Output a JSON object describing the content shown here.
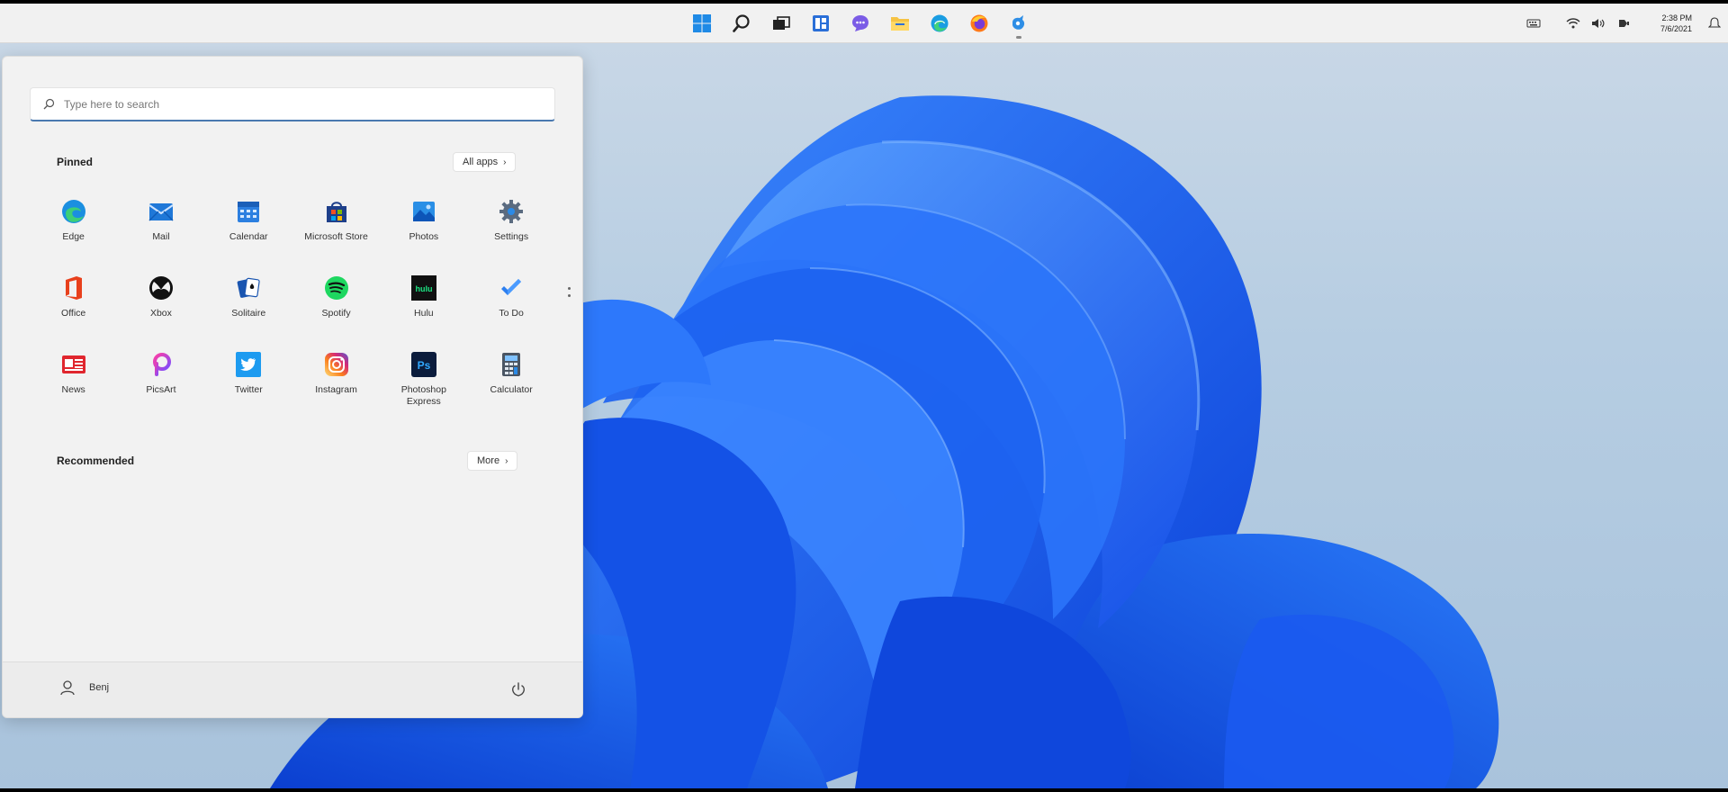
{
  "taskbar": {
    "apps": [
      {
        "name": "start-button",
        "icon": "windows-logo-icon"
      },
      {
        "name": "search-button",
        "icon": "search-icon"
      },
      {
        "name": "task-view-button",
        "icon": "task-view-icon"
      },
      {
        "name": "widgets-button",
        "icon": "widgets-icon"
      },
      {
        "name": "chat-button",
        "icon": "chat-icon"
      },
      {
        "name": "file-explorer-button",
        "icon": "folder-icon"
      },
      {
        "name": "edge-button",
        "icon": "edge-icon"
      },
      {
        "name": "firefox-button",
        "icon": "firefox-icon"
      },
      {
        "name": "app-button",
        "icon": "app-icon"
      }
    ],
    "clock": {
      "time": "2:38 PM",
      "date": "7/6/2021"
    }
  },
  "start_menu": {
    "search": {
      "placeholder": "Type here to search"
    },
    "pinned": {
      "title": "Pinned",
      "all_apps_label": "All apps",
      "apps": [
        {
          "label": "Edge",
          "icon": "edge-icon"
        },
        {
          "label": "Mail",
          "icon": "mail-icon"
        },
        {
          "label": "Calendar",
          "icon": "calendar-icon"
        },
        {
          "label": "Microsoft Store",
          "icon": "store-icon"
        },
        {
          "label": "Photos",
          "icon": "photos-icon"
        },
        {
          "label": "Settings",
          "icon": "gear-icon"
        },
        {
          "label": "Office",
          "icon": "office-icon"
        },
        {
          "label": "Xbox",
          "icon": "xbox-icon"
        },
        {
          "label": "Solitaire",
          "icon": "solitaire-icon"
        },
        {
          "label": "Spotify",
          "icon": "spotify-icon"
        },
        {
          "label": "Hulu",
          "icon": "hulu-icon"
        },
        {
          "label": "To Do",
          "icon": "todo-icon"
        },
        {
          "label": "News",
          "icon": "news-icon"
        },
        {
          "label": "PicsArt",
          "icon": "picsart-icon"
        },
        {
          "label": "Twitter",
          "icon": "twitter-icon"
        },
        {
          "label": "Instagram",
          "icon": "instagram-icon"
        },
        {
          "label": "Photoshop Express",
          "icon": "photoshop-icon"
        },
        {
          "label": "Calculator",
          "icon": "calculator-icon"
        }
      ]
    },
    "recommended": {
      "title": "Recommended",
      "more_label": "More"
    },
    "user": {
      "name": "Benj"
    }
  },
  "colors": {
    "accent": "#4a79b0",
    "wallpaper_blue": "#1a5cf0"
  }
}
